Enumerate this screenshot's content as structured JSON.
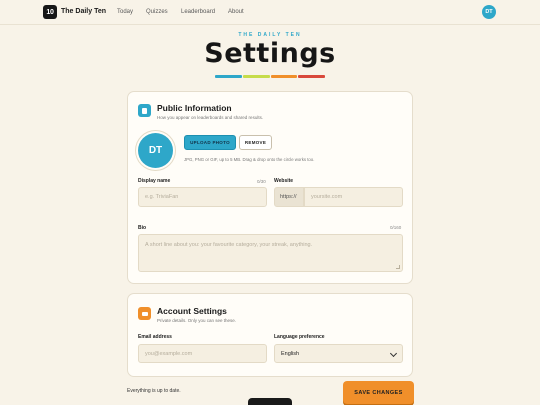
{
  "nav": {
    "logo_text": "10",
    "brand": "The Daily Ten",
    "links": [
      "Today",
      "Quizzes",
      "Leaderboard",
      "About"
    ],
    "avatar_initials": "DT"
  },
  "header": {
    "eyebrow": "THE DAILY TEN",
    "title": "Settings",
    "stripe_colors": [
      "#2ea7c9",
      "#c6dc4a",
      "#f08f2a",
      "#d9483b"
    ]
  },
  "public_info": {
    "icon": "profile-card-icon",
    "title": "Public Information",
    "subtitle": "How you appear on leaderboards and shared results.",
    "avatar_initials": "DT",
    "upload_label": "UPLOAD PHOTO",
    "remove_label": "REMOVE",
    "upload_hint": "JPG, PNG or GIF, up to 5 MB. Drag & drop onto the circle works too.",
    "display_name": {
      "label": "Display name",
      "counter": "0/30",
      "placeholder": "e.g. TriviaFan"
    },
    "website": {
      "label": "Website",
      "prefix": "https://",
      "placeholder": "yoursite.com"
    },
    "bio": {
      "label": "Bio",
      "counter": "0/160",
      "placeholder": "A short line about you: your favourite category, your streak, anything."
    }
  },
  "account": {
    "icon": "account-card-icon",
    "title": "Account Settings",
    "subtitle": "Private details. Only you can see these.",
    "email": {
      "label": "Email address",
      "placeholder": "you@example.com"
    },
    "language": {
      "label": "Language preference",
      "value": "English"
    }
  },
  "footer": {
    "status": "Everything is up to date.",
    "save_label": "SAVE CHANGES"
  },
  "colors": {
    "accent_blue": "#2ea7c9",
    "accent_orange": "#f08f2a",
    "background": "#f8f3e8"
  }
}
